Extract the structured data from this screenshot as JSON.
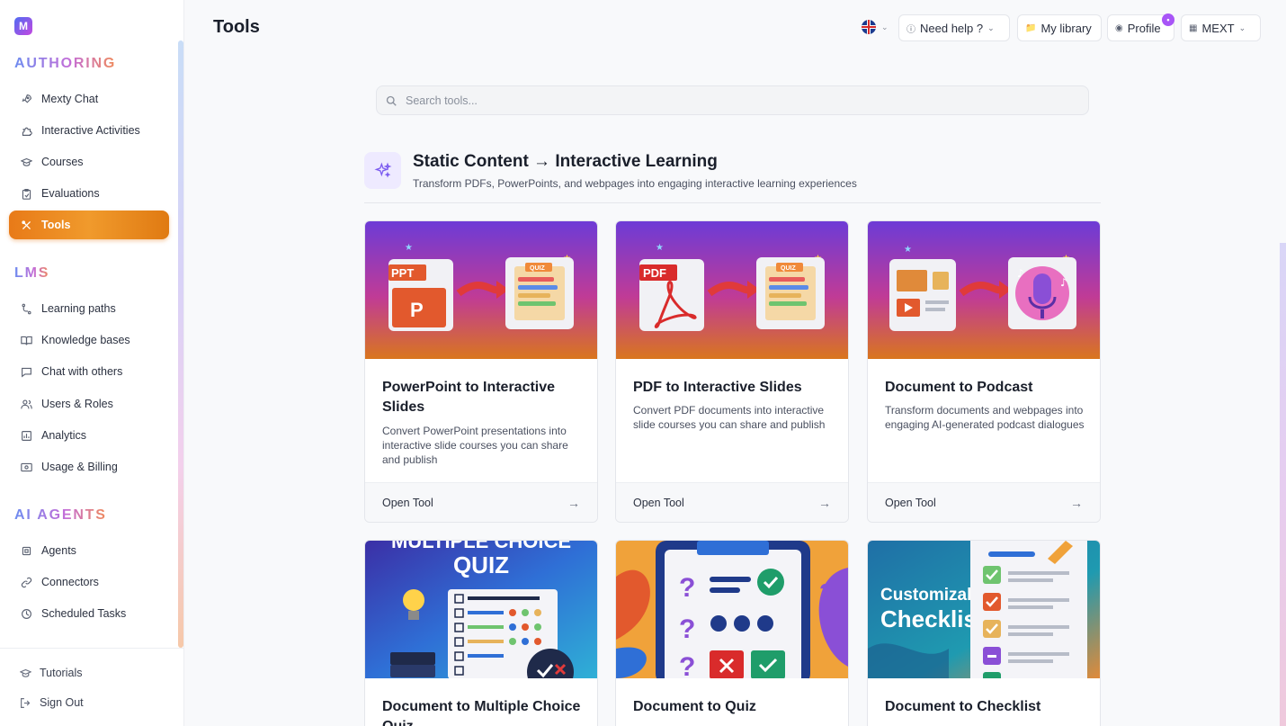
{
  "app": {
    "logo_letter": "M"
  },
  "sidebar": {
    "sections": [
      {
        "title": "AUTHORING"
      },
      {
        "title": "LMS"
      },
      {
        "title": "AI AGENTS"
      }
    ],
    "authoring": [
      {
        "label": "Mexty Chat",
        "icon": "rocket-icon"
      },
      {
        "label": "Interactive Activities",
        "icon": "puzzle-icon"
      },
      {
        "label": "Courses",
        "icon": "graduation-cap-icon"
      },
      {
        "label": "Evaluations",
        "icon": "clipboard-check-icon"
      },
      {
        "label": "Tools",
        "icon": "tools-icon",
        "active": true
      }
    ],
    "lms": [
      {
        "label": "Learning paths",
        "icon": "route-icon"
      },
      {
        "label": "Knowledge bases",
        "icon": "book-open-icon"
      },
      {
        "label": "Chat with others",
        "icon": "chat-icon"
      },
      {
        "label": "Users & Roles",
        "icon": "users-icon"
      },
      {
        "label": "Analytics",
        "icon": "bar-chart-icon"
      },
      {
        "label": "Usage & Billing",
        "icon": "billing-icon"
      }
    ],
    "agents": [
      {
        "label": "Agents",
        "icon": "cpu-icon"
      },
      {
        "label": "Connectors",
        "icon": "link-icon"
      },
      {
        "label": "Scheduled Tasks",
        "icon": "clock-icon"
      }
    ],
    "bottom": [
      {
        "label": "Tutorials",
        "icon": "graduation-cap-icon"
      },
      {
        "label": "Sign Out",
        "icon": "sign-out-icon"
      }
    ]
  },
  "header": {
    "title": "Tools",
    "help_label": "Need help ?",
    "library_label": "My library",
    "profile_label": "Profile",
    "profile_badge": "•",
    "org_label": "MEXT"
  },
  "search": {
    "placeholder": "Search tools..."
  },
  "section": {
    "title": "Static Content → Interactive Learning",
    "subtitle": "Transform PDFs, PowerPoints, and webpages into engaging interactive learning experiences"
  },
  "cards": [
    {
      "title": "PowerPoint to Interactive Slides",
      "description": "Convert PowerPoint presentations into interactive slide courses you can share and publish",
      "cta": "Open Tool",
      "image_tag": "PPT",
      "image_target": "QUIZ"
    },
    {
      "title": "PDF to Interactive Slides",
      "description": "Convert PDF documents into interactive slide courses you can share and publish",
      "cta": "Open Tool",
      "image_tag": "PDF",
      "image_target": "QUIZ"
    },
    {
      "title": "Document to Podcast",
      "description": "Transform documents and webpages into engaging AI-generated podcast dialogues",
      "cta": "Open Tool"
    },
    {
      "title": "Document to Multiple Choice Quiz",
      "image_text_1": "MULTIPLE CHOICE",
      "image_text_2": "QUIZ"
    },
    {
      "title": "Document to Quiz"
    },
    {
      "title": "Document to Checklist",
      "image_text_1": "Customizable",
      "image_text_2": "Checklist"
    }
  ],
  "colors": {
    "accent": "#e87a18",
    "section_icon_bg": "#eeeaff",
    "brand_gradient_start": "#6d8cf0",
    "brand_gradient_end": "#f08a5a"
  }
}
